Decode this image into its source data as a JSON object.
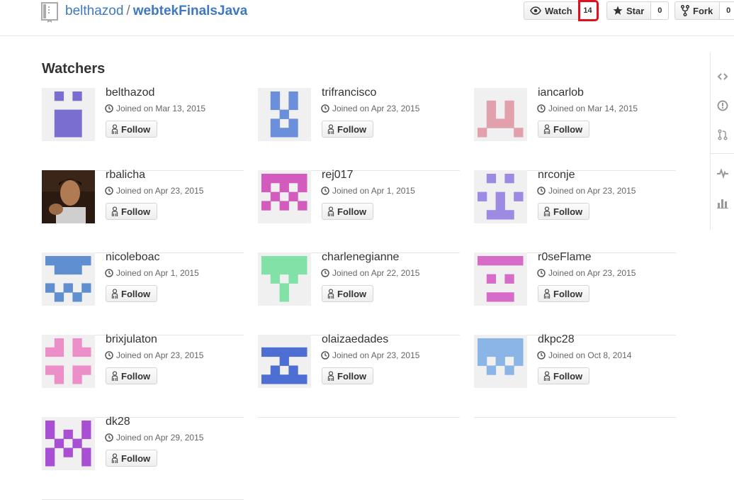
{
  "repo": {
    "owner": "belthazod",
    "separator": "/",
    "name": "webtekFinalsJava"
  },
  "actions": {
    "watch_label": "Watch",
    "watch_count": "14",
    "star_label": "Star",
    "star_count": "0",
    "fork_label": "Fork",
    "fork_count": "0"
  },
  "section_title": "Watchers",
  "follow_label": "Follow",
  "watchers": [
    {
      "username": "belthazod",
      "joined": "Joined on Mar 13, 2015"
    },
    {
      "username": "trifrancisco",
      "joined": "Joined on Apr 23, 2015"
    },
    {
      "username": "iancarlob",
      "joined": "Joined on Mar 14, 2015"
    },
    {
      "username": "rbalicha",
      "joined": "Joined on Apr 23, 2015"
    },
    {
      "username": "rej017",
      "joined": "Joined on Apr 1, 2015"
    },
    {
      "username": "nrconje",
      "joined": "Joined on Apr 23, 2015"
    },
    {
      "username": "nicoleboac",
      "joined": "Joined on Apr 1, 2015"
    },
    {
      "username": "charlenegianne",
      "joined": "Joined on Apr 22, 2015"
    },
    {
      "username": "r0seFlame",
      "joined": "Joined on Apr 23, 2015"
    },
    {
      "username": "brixjulaton",
      "joined": "Joined on Apr 23, 2015"
    },
    {
      "username": "olaizaedades",
      "joined": "Joined on Apr 23, 2015"
    },
    {
      "username": "dkpc28",
      "joined": "Joined on Oct 8, 2014"
    },
    {
      "username": "dk28",
      "joined": "Joined on Apr 29, 2015"
    }
  ],
  "colors": {
    "link": "#4078c0",
    "highlight": "#e0111e",
    "identicons": [
      "#7a6fd1",
      "#6b8fdb",
      "#e2a0ad",
      "photo",
      "#d35bbd",
      "#9d8ae3",
      "#5f8fcf",
      "#82e1a7",
      "#d66cc7",
      "#ec8fc9",
      "#4d6ed3",
      "#8ab5e6",
      "#a84fd3"
    ]
  },
  "sidebar_icons": [
    "code-icon",
    "issues-icon",
    "pull-request-icon",
    "pulse-icon",
    "graphs-icon"
  ]
}
